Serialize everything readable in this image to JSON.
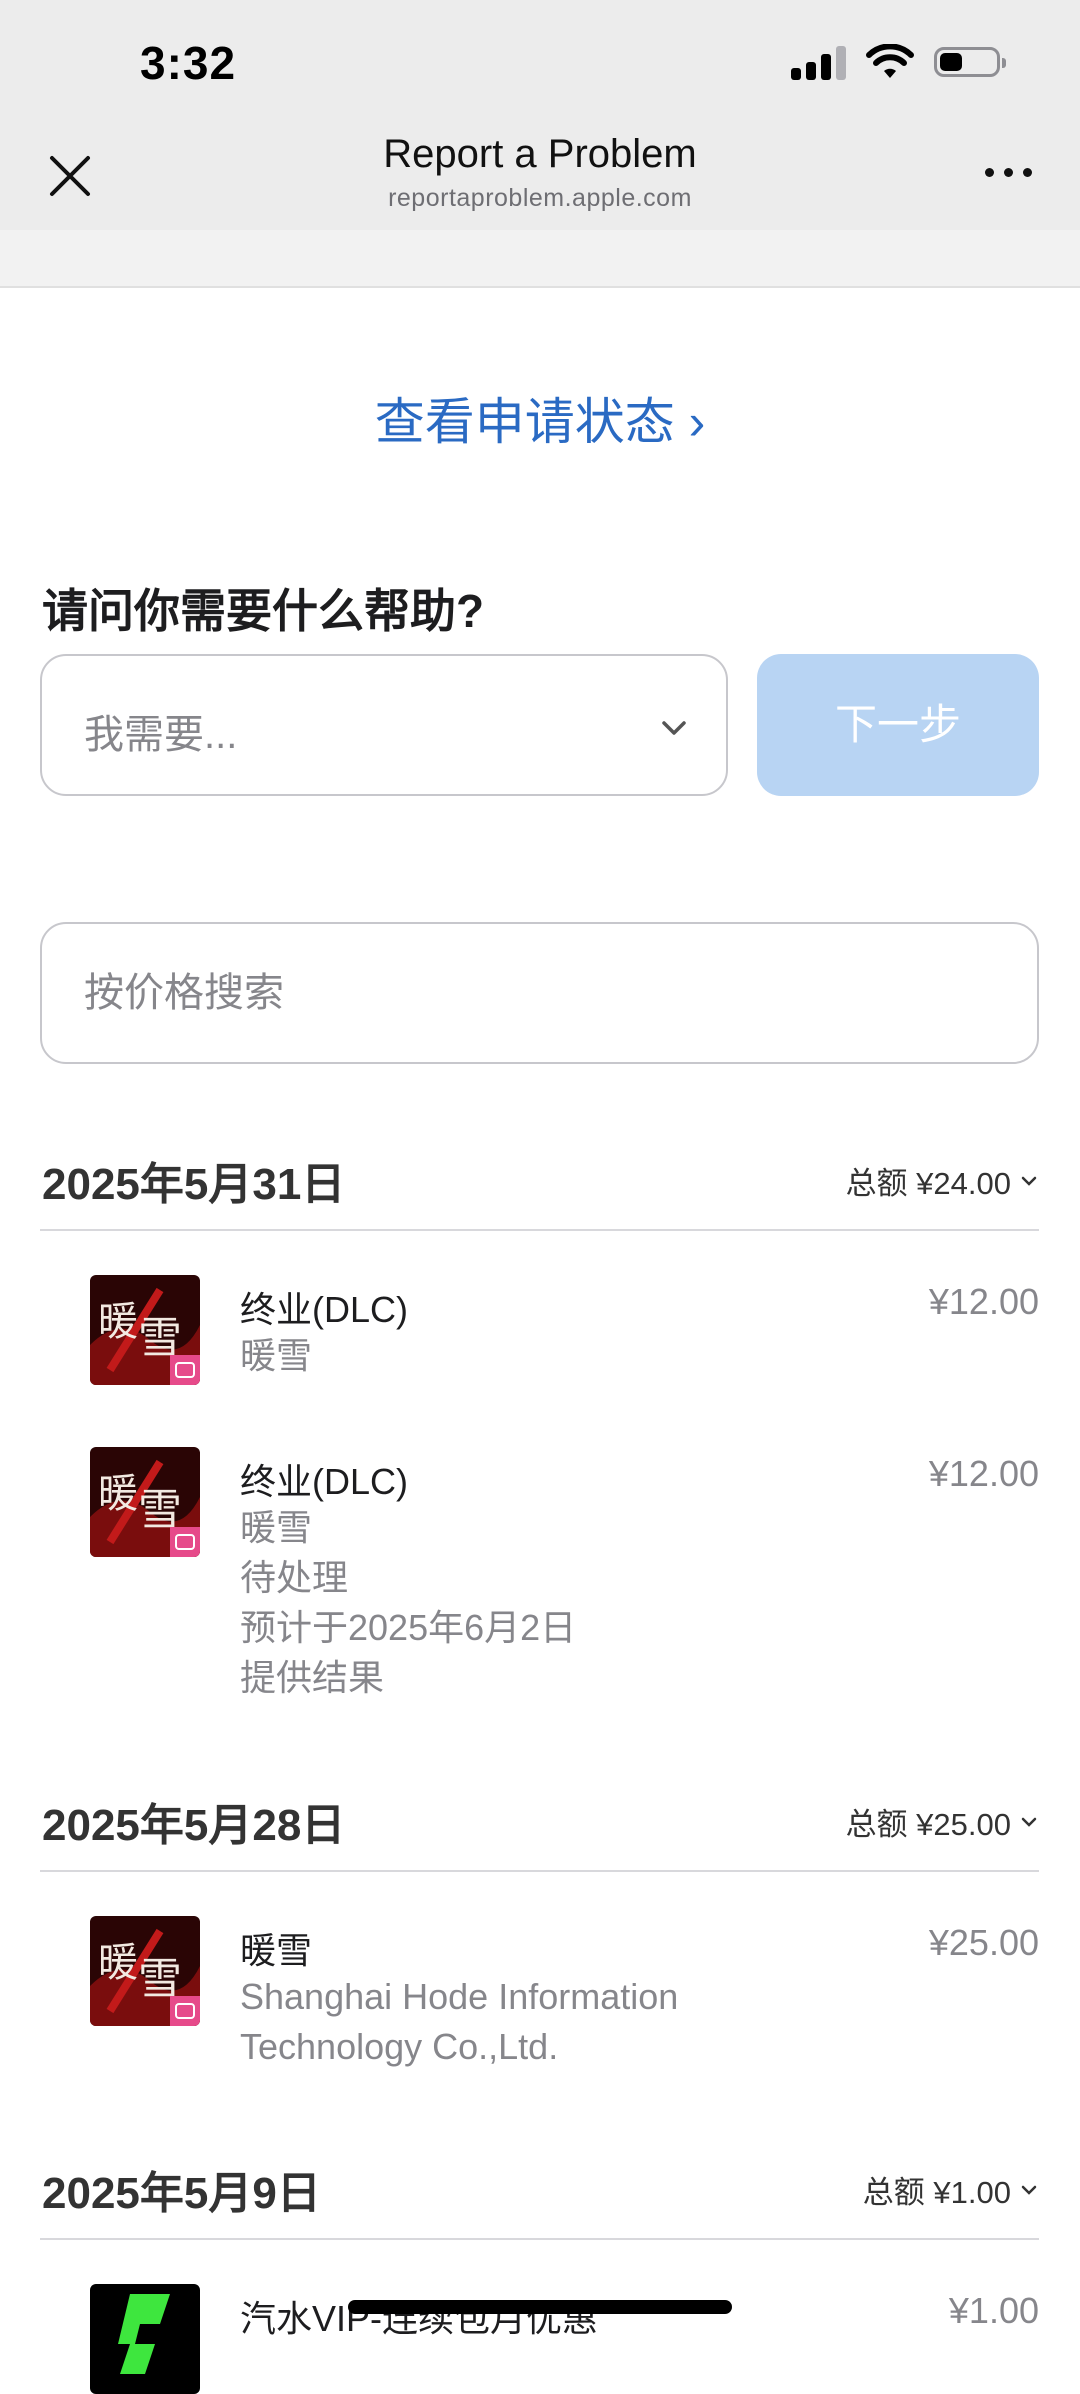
{
  "status": {
    "time": "3:32"
  },
  "header": {
    "title": "Report a Problem",
    "url": "reportaproblem.apple.com"
  },
  "view_status": "查看申请状态 ›",
  "help": {
    "heading": "请问你需要什么帮助?",
    "select_value": "我需要...",
    "next_label": "下一步",
    "search_placeholder": "按价格搜索"
  },
  "groups": [
    {
      "date": "2025年5月31日",
      "total": "总额 ¥24.00",
      "items": [
        {
          "title": "终业(DLC)",
          "lines": [
            "暖雪"
          ],
          "price": "¥12.00",
          "thumb_text": "暖雪"
        },
        {
          "title": "终业(DLC)",
          "lines": [
            "暖雪",
            "待处理",
            "预计于2025年6月2日",
            "提供结果"
          ],
          "price": "¥12.00",
          "thumb_text": "暖雪"
        }
      ]
    },
    {
      "date": "2025年5月28日",
      "total": "总额 ¥25.00",
      "items": [
        {
          "title": "暖雪",
          "lines": [
            "Shanghai Hode Information",
            "Technology Co.,Ltd."
          ],
          "price": "¥25.00",
          "thumb_text": "暖雪"
        }
      ]
    },
    {
      "date": "2025年5月9日",
      "total": "总额 ¥1.00",
      "items": [
        {
          "title": "汽水VIP-连续包月优惠",
          "lines": [],
          "price": "¥1.00"
        }
      ]
    }
  ],
  "colors": {
    "link": "#2a6ac3",
    "next_disabled": "#b8d4f3",
    "thumb_red": "#7a0d0d",
    "thumb_pink": "#e64a8a"
  }
}
